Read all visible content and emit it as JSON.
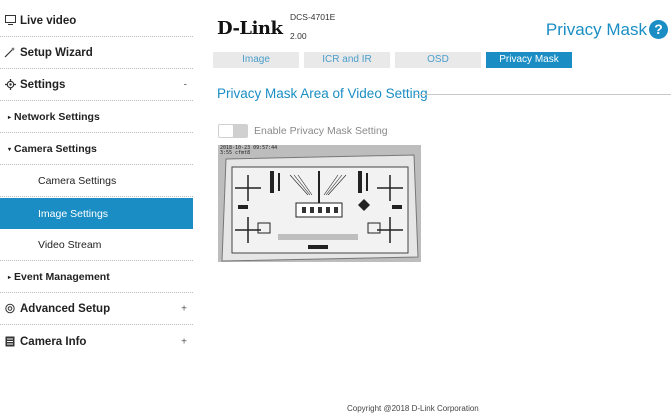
{
  "sidebar": {
    "live_video": "Live video",
    "setup_wizard": "Setup Wizard",
    "settings": "Settings",
    "settings_toggle": "-",
    "network_settings": "Network Settings",
    "camera_settings": "Camera Settings",
    "camera_settings_leaf": "Camera Settings",
    "image_settings": "Image Settings",
    "video_stream": "Video Stream",
    "event_management": "Event Management",
    "advanced_setup": "Advanced Setup",
    "advanced_toggle": "+",
    "camera_info": "Camera Info",
    "camera_info_toggle": "+",
    "collapsed_marker": "▸",
    "expanded_marker": "▾"
  },
  "header": {
    "logo": "D-Link",
    "model": "DCS-4701E",
    "version": "2.00",
    "page_title": "Privacy Mask",
    "help": "?"
  },
  "tabs": [
    {
      "label": "Image",
      "active": false
    },
    {
      "label": "ICR and IR",
      "active": false
    },
    {
      "label": "OSD",
      "active": false
    },
    {
      "label": "Privacy Mask",
      "active": true
    }
  ],
  "section": {
    "title": "Privacy Mask Area of Video Setting",
    "enable_label": "Enable Privacy Mask Setting",
    "enable_checked": false
  },
  "video": {
    "osd_date": "2018-10-23 09:57:44",
    "osd_time": "3:55 cfmt8"
  },
  "footer": {
    "copyright": "Copyright @2018 D-Link Corporation"
  },
  "colors": {
    "accent": "#1a8ec4",
    "tab_inactive": "#e9e9e9",
    "tab_inactive_text": "#4a9ecb"
  }
}
